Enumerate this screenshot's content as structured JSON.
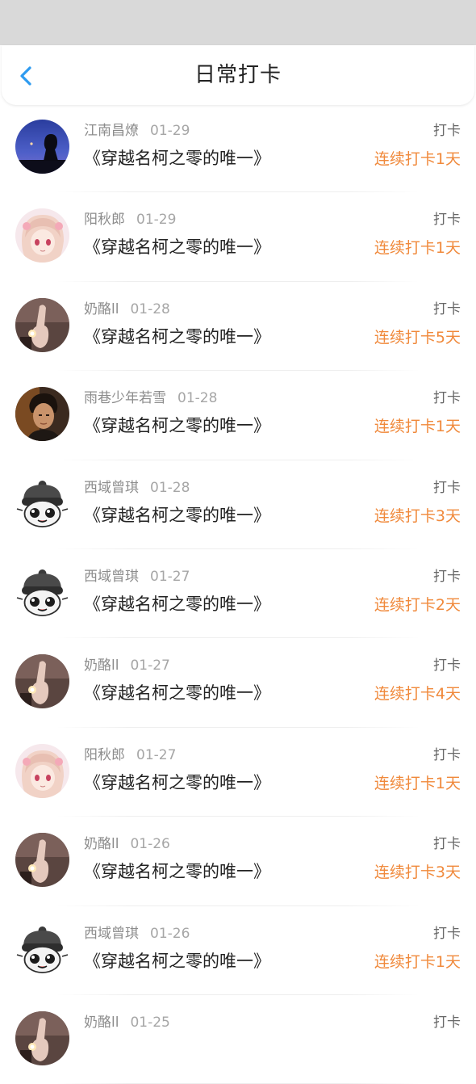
{
  "header": {
    "title": "日常打卡"
  },
  "colors": {
    "accent_blue": "#2e9bf0",
    "streak_orange": "#f0893b",
    "status_bar": "#d9d9d9"
  },
  "entries": [
    {
      "user": "江南昌燎",
      "date": "01-29",
      "book": "《穿越名柯之零的唯一》",
      "action": "打卡",
      "streak": "连续打卡1天",
      "avatar": "night-silhouette-avatar"
    },
    {
      "user": "阳秋郎",
      "date": "01-29",
      "book": "《穿越名柯之零的唯一》",
      "action": "打卡",
      "streak": "连续打卡1天",
      "avatar": "anime-girl-avatar"
    },
    {
      "user": "奶酪ll",
      "date": "01-28",
      "book": "《穿越名柯之零的唯一》",
      "action": "打卡",
      "streak": "连续打卡5天",
      "avatar": "candle-hand-avatar"
    },
    {
      "user": "雨巷少年若雪",
      "date": "01-28",
      "book": "《穿越名柯之零的唯一》",
      "action": "打卡",
      "streak": "连续打卡1天",
      "avatar": "portrait-man-avatar"
    },
    {
      "user": "西域曾琪",
      "date": "01-28",
      "book": "《穿越名柯之零的唯一》",
      "action": "打卡",
      "streak": "连续打卡3天",
      "avatar": "cartoon-mascot-avatar"
    },
    {
      "user": "西域曾琪",
      "date": "01-27",
      "book": "《穿越名柯之零的唯一》",
      "action": "打卡",
      "streak": "连续打卡2天",
      "avatar": "cartoon-mascot-avatar"
    },
    {
      "user": "奶酪ll",
      "date": "01-27",
      "book": "《穿越名柯之零的唯一》",
      "action": "打卡",
      "streak": "连续打卡4天",
      "avatar": "candle-hand-avatar"
    },
    {
      "user": "阳秋郎",
      "date": "01-27",
      "book": "《穿越名柯之零的唯一》",
      "action": "打卡",
      "streak": "连续打卡1天",
      "avatar": "anime-girl-avatar"
    },
    {
      "user": "奶酪ll",
      "date": "01-26",
      "book": "《穿越名柯之零的唯一》",
      "action": "打卡",
      "streak": "连续打卡3天",
      "avatar": "candle-hand-avatar"
    },
    {
      "user": "西域曾琪",
      "date": "01-26",
      "book": "《穿越名柯之零的唯一》",
      "action": "打卡",
      "streak": "连续打卡1天",
      "avatar": "cartoon-mascot-avatar"
    },
    {
      "user": "奶酪ll",
      "date": "01-25",
      "book": "",
      "action": "打卡",
      "streak": "",
      "avatar": "candle-hand-avatar"
    }
  ]
}
